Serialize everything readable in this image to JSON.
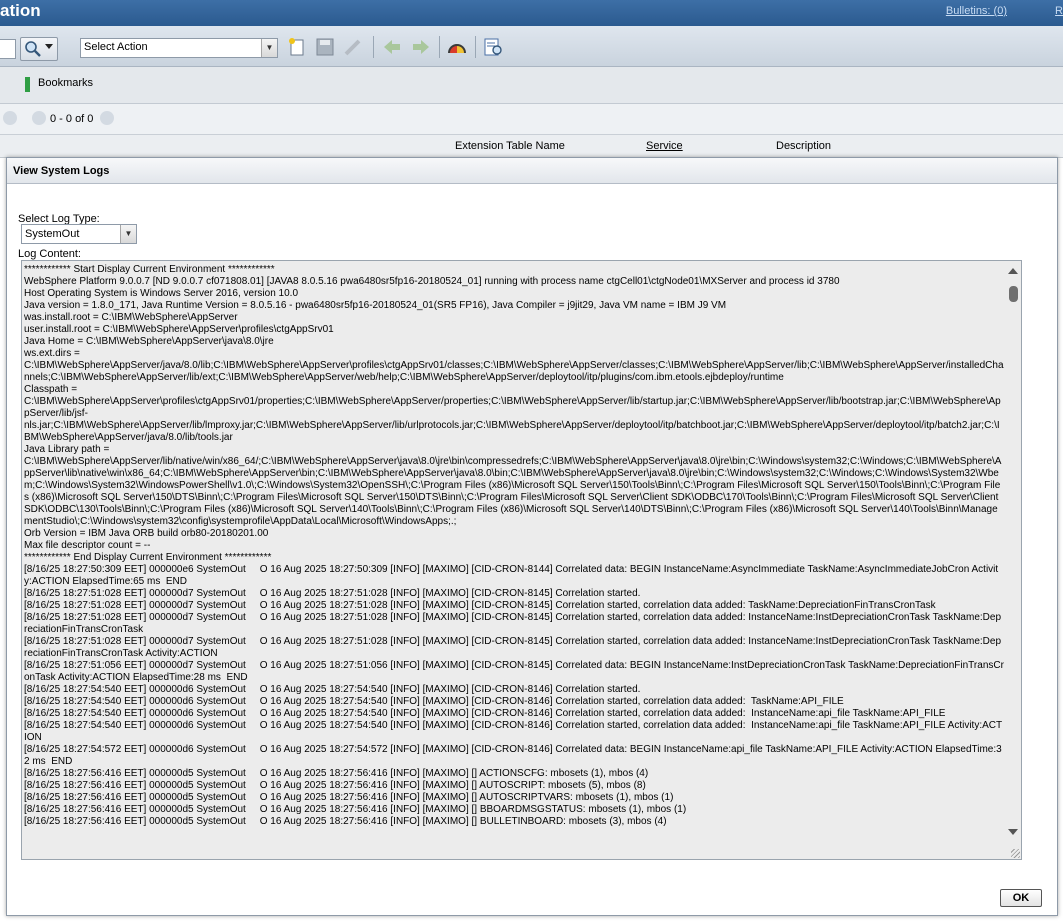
{
  "header": {
    "title": "ation",
    "bulletins": "Bulletins: (0)",
    "right_link": "R"
  },
  "toolbar": {
    "select_action_label": "Select Action",
    "icons": [
      "search-icon",
      "new-record-icon",
      "save-icon",
      "clear-changes-icon",
      "previous-record-icon",
      "next-record-icon",
      "dashboard-icon",
      "view-log-icon"
    ]
  },
  "bookmarks": {
    "label": "Bookmarks"
  },
  "pager": {
    "text": "0 - 0 of 0"
  },
  "table": {
    "columns": [
      "Extension Table Name",
      "Service",
      "Description"
    ]
  },
  "dialog": {
    "title": "View System Logs",
    "log_type_label": "Select Log Type:",
    "log_type_value": "SystemOut",
    "log_content_label": "Log Content:",
    "ok_label": "OK",
    "log_content": "************ Start Display Current Environment ************\nWebSphere Platform 9.0.0.7 [ND 9.0.0.7 cf071808.01] [JAVA8 8.0.5.16 pwa6480sr5fp16-20180524_01] running with process name ctgCell01\\ctgNode01\\MXServer and process id 3780\nHost Operating System is Windows Server 2016, version 10.0\nJava version = 1.8.0_171, Java Runtime Version = 8.0.5.16 - pwa6480sr5fp16-20180524_01(SR5 FP16), Java Compiler = j9jit29, Java VM name = IBM J9 VM\nwas.install.root = C:\\IBM\\WebSphere\\AppServer\nuser.install.root = C:\\IBM\\WebSphere\\AppServer\\profiles\\ctgAppSrv01\nJava Home = C:\\IBM\\WebSphere\\AppServer\\java\\8.0\\jre\nws.ext.dirs =\nC:\\IBM\\WebSphere\\AppServer/java/8.0/lib;C:\\IBM\\WebSphere\\AppServer\\profiles\\ctgAppSrv01/classes;C:\\IBM\\WebSphere\\AppServer/classes;C:\\IBM\\WebSphere\\AppServer/lib;C:\\IBM\\WebSphere\\AppServer/installedChannels;C:\\IBM\\WebSphere\\AppServer/lib/ext;C:\\IBM\\WebSphere\\AppServer/web/help;C:\\IBM\\WebSphere\\AppServer/deploytool/itp/plugins/com.ibm.etools.ejbdeploy/runtime\nClasspath =\nC:\\IBM\\WebSphere\\AppServer\\profiles\\ctgAppSrv01/properties;C:\\IBM\\WebSphere\\AppServer/properties;C:\\IBM\\WebSphere\\AppServer/lib/startup.jar;C:\\IBM\\WebSphere\\AppServer/lib/bootstrap.jar;C:\\IBM\\WebSphere\\AppServer/lib/jsf-\nnls.jar;C:\\IBM\\WebSphere\\AppServer/lib/lmproxy.jar;C:\\IBM\\WebSphere\\AppServer/lib/urlprotocols.jar;C:\\IBM\\WebSphere\\AppServer/deploytool/itp/batchboot.jar;C:\\IBM\\WebSphere\\AppServer/deploytool/itp/batch2.jar;C:\\IBM\\WebSphere\\AppServer/java/8.0/lib/tools.jar\nJava Library path =\nC:\\IBM\\WebSphere\\AppServer/lib/native/win/x86_64/;C:\\IBM\\WebSphere\\AppServer\\java\\8.0\\jre\\bin\\compressedrefs;C:\\IBM\\WebSphere\\AppServer\\java\\8.0\\jre\\bin;C:\\Windows\\system32;C:\\Windows;C:\\IBM\\WebSphere\\AppServer\\lib\\native\\win\\x86_64;C:\\IBM\\WebSphere\\AppServer\\bin;C:\\IBM\\WebSphere\\AppServer\\java\\8.0\\bin;C:\\IBM\\WebSphere\\AppServer\\java\\8.0\\jre\\bin;C:\\Windows\\system32;C:\\Windows;C:\\Windows\\System32\\Wbem;C:\\Windows\\System32\\WindowsPowerShell\\v1.0\\;C:\\Windows\\System32\\OpenSSH\\;C:\\Program Files (x86)\\Microsoft SQL Server\\150\\Tools\\Binn\\;C:\\Program Files\\Microsoft SQL Server\\150\\Tools\\Binn\\;C:\\Program Files (x86)\\Microsoft SQL Server\\150\\DTS\\Binn\\;C:\\Program Files\\Microsoft SQL Server\\150\\DTS\\Binn\\;C:\\Program Files\\Microsoft SQL Server\\Client SDK\\ODBC\\170\\Tools\\Binn\\;C:\\Program Files\\Microsoft SQL Server\\Client SDK\\ODBC\\130\\Tools\\Binn\\;C:\\Program Files (x86)\\Microsoft SQL Server\\140\\Tools\\Binn\\;C:\\Program Files (x86)\\Microsoft SQL Server\\140\\DTS\\Binn\\;C:\\Program Files (x86)\\Microsoft SQL Server\\140\\Tools\\Binn\\ManagementStudio\\;C:\\Windows\\system32\\config\\systemprofile\\AppData\\Local\\Microsoft\\WindowsApps;.;\nOrb Version = IBM Java ORB build orb80-20180201.00\nMax file descriptor count = --\n************ End Display Current Environment ************\n[8/16/25 18:27:50:309 EET] 000000e6 SystemOut     O 16 Aug 2025 18:27:50:309 [INFO] [MAXIMO] [CID-CRON-8144] Correlated data: BEGIN InstanceName:AsyncImmediate TaskName:AsyncImmediateJobCron Activity:ACTION ElapsedTime:65 ms  END\n[8/16/25 18:27:51:028 EET] 000000d7 SystemOut     O 16 Aug 2025 18:27:51:028 [INFO] [MAXIMO] [CID-CRON-8145] Correlation started.\n[8/16/25 18:27:51:028 EET] 000000d7 SystemOut     O 16 Aug 2025 18:27:51:028 [INFO] [MAXIMO] [CID-CRON-8145] Correlation started, correlation data added: TaskName:DepreciationFinTransCronTask\n[8/16/25 18:27:51:028 EET] 000000d7 SystemOut     O 16 Aug 2025 18:27:51:028 [INFO] [MAXIMO] [CID-CRON-8145] Correlation started, correlation data added: InstanceName:InstDepreciationCronTask TaskName:DepreciationFinTransCronTask\n[8/16/25 18:27:51:028 EET] 000000d7 SystemOut     O 16 Aug 2025 18:27:51:028 [INFO] [MAXIMO] [CID-CRON-8145] Correlation started, correlation data added: InstanceName:InstDepreciationCronTask TaskName:DepreciationFinTransCronTask Activity:ACTION\n[8/16/25 18:27:51:056 EET] 000000d7 SystemOut     O 16 Aug 2025 18:27:51:056 [INFO] [MAXIMO] [CID-CRON-8145] Correlated data: BEGIN InstanceName:InstDepreciationCronTask TaskName:DepreciationFinTransCronTask Activity:ACTION ElapsedTime:28 ms  END\n[8/16/25 18:27:54:540 EET] 000000d6 SystemOut     O 16 Aug 2025 18:27:54:540 [INFO] [MAXIMO] [CID-CRON-8146] Correlation started.\n[8/16/25 18:27:54:540 EET] 000000d6 SystemOut     O 16 Aug 2025 18:27:54:540 [INFO] [MAXIMO] [CID-CRON-8146] Correlation started, correlation data added:  TaskName:API_FILE\n[8/16/25 18:27:54:540 EET] 000000d6 SystemOut     O 16 Aug 2025 18:27:54:540 [INFO] [MAXIMO] [CID-CRON-8146] Correlation started, correlation data added:  InstanceName:api_file TaskName:API_FILE\n[8/16/25 18:27:54:540 EET] 000000d6 SystemOut     O 16 Aug 2025 18:27:54:540 [INFO] [MAXIMO] [CID-CRON-8146] Correlation started, correlation data added:  InstanceName:api_file TaskName:API_FILE Activity:ACTION\n[8/16/25 18:27:54:572 EET] 000000d6 SystemOut     O 16 Aug 2025 18:27:54:572 [INFO] [MAXIMO] [CID-CRON-8146] Correlated data: BEGIN InstanceName:api_file TaskName:API_FILE Activity:ACTION ElapsedTime:32 ms  END\n[8/16/25 18:27:56:416 EET] 000000d5 SystemOut     O 16 Aug 2025 18:27:56:416 [INFO] [MAXIMO] [] ACTIONSCFG: mbosets (1), mbos (4)\n[8/16/25 18:27:56:416 EET] 000000d5 SystemOut     O 16 Aug 2025 18:27:56:416 [INFO] [MAXIMO] [] AUTOSCRIPT: mbosets (5), mbos (8)\n[8/16/25 18:27:56:416 EET] 000000d5 SystemOut     O 16 Aug 2025 18:27:56:416 [INFO] [MAXIMO] [] AUTOSCRIPTVARS: mbosets (1), mbos (1)\n[8/16/25 18:27:56:416 EET] 000000d5 SystemOut     O 16 Aug 2025 18:27:56:416 [INFO] [MAXIMO] [] BBOARDMSGSTATUS: mbosets (1), mbos (1)\n[8/16/25 18:27:56:416 EET] 000000d5 SystemOut     O 16 Aug 2025 18:27:56:416 [INFO] [MAXIMO] [] BULLETINBOARD: mbosets (3), mbos (4)"
  }
}
